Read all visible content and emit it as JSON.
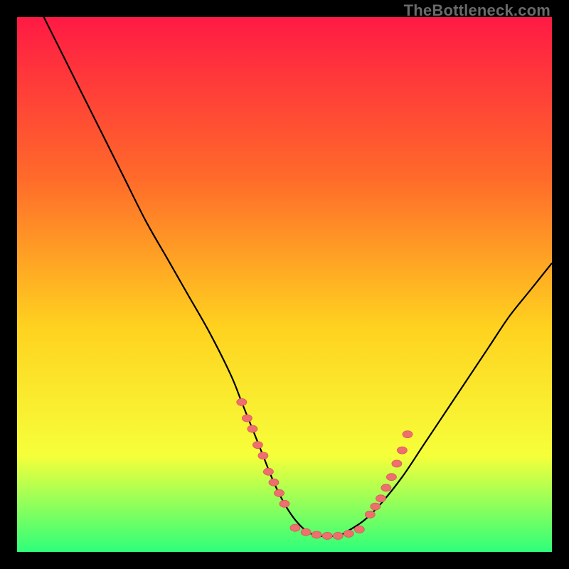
{
  "watermark": "TheBottleneck.com",
  "colors": {
    "background": "#000000",
    "gradient_top": "#ff1a44",
    "gradient_mid_upper": "#ff6a2a",
    "gradient_mid": "#ffd21f",
    "gradient_lower": "#f6ff3a",
    "gradient_bottom": "#2eff7a",
    "curve": "#000000",
    "marker_fill": "#ef6e6e",
    "marker_stroke": "#d65a5a"
  },
  "chart_data": {
    "type": "line",
    "title": "",
    "xlabel": "",
    "ylabel": "",
    "xlim": [
      0,
      100
    ],
    "ylim": [
      0,
      100
    ],
    "grid": false,
    "legend": false,
    "series": [
      {
        "name": "bottleneck-curve",
        "x": [
          5,
          8,
          12,
          16,
          20,
          24,
          28,
          32,
          36,
          40,
          42,
          44,
          46,
          48,
          50,
          52,
          54,
          56,
          58,
          60,
          62,
          65,
          68,
          72,
          76,
          80,
          84,
          88,
          92,
          96,
          100
        ],
        "y": [
          100,
          94,
          86,
          78,
          70,
          62,
          55,
          48,
          41,
          33,
          28,
          23,
          18,
          13,
          9,
          6,
          4,
          3,
          3,
          3,
          4,
          6,
          9,
          14,
          20,
          26,
          32,
          38,
          44,
          49,
          54
        ]
      }
    ],
    "markers_left": {
      "x": [
        42,
        43,
        44,
        45,
        46,
        47,
        48,
        49,
        50
      ],
      "y": [
        28,
        25,
        23,
        20,
        18,
        15,
        13,
        11,
        9
      ]
    },
    "markers_bottom": {
      "x": [
        52,
        54,
        56,
        58,
        60,
        62,
        64
      ],
      "y": [
        4.5,
        3.7,
        3.2,
        3.0,
        3.0,
        3.4,
        4.2
      ]
    },
    "markers_right": {
      "x": [
        66,
        67,
        68,
        69,
        70,
        71,
        72,
        73
      ],
      "y": [
        7,
        8.5,
        10,
        12,
        14,
        16.5,
        19,
        22
      ]
    }
  }
}
